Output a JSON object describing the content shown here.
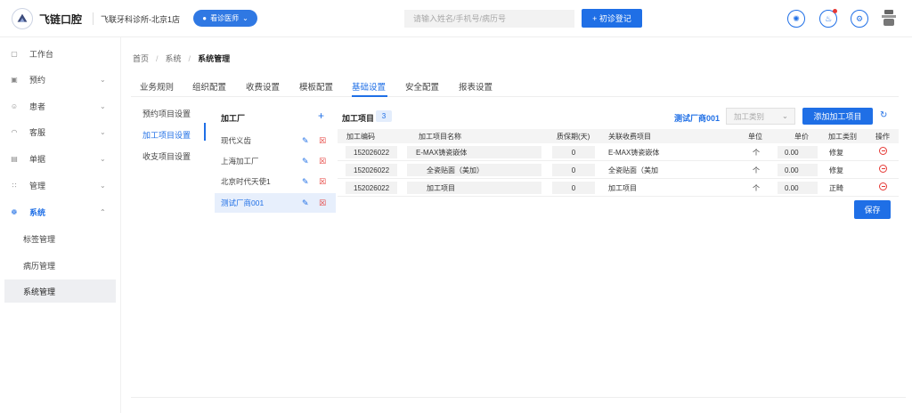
{
  "header": {
    "brand": "飞链口腔",
    "clinic": "飞联牙科诊所-北京1店",
    "role": "看诊医师",
    "search_placeholder": "请输入姓名/手机号/病历号",
    "register_label": "+ 初诊登记",
    "icons": [
      "sun-icon",
      "bell-icon",
      "settings-icon",
      "avatar-icon"
    ]
  },
  "sidebar": {
    "items": [
      {
        "label": "工作台",
        "icon": "monitor-icon"
      },
      {
        "label": "预约",
        "icon": "calendar-icon"
      },
      {
        "label": "患者",
        "icon": "user-icon"
      },
      {
        "label": "客服",
        "icon": "headset-icon"
      },
      {
        "label": "单据",
        "icon": "receipt-icon"
      },
      {
        "label": "管理",
        "icon": "grid-icon"
      },
      {
        "label": "系统",
        "icon": "gear-icon"
      }
    ],
    "sub_items": [
      "标签管理",
      "病历管理",
      "系统管理"
    ]
  },
  "breadcrumb": [
    "首页",
    "系统",
    "系统管理"
  ],
  "tabs": [
    "业务规则",
    "组织配置",
    "收费设置",
    "模板配置",
    "基础设置",
    "安全配置",
    "报表设置"
  ],
  "submenu": [
    "预约项目设置",
    "加工项目设置",
    "收支项目设置"
  ],
  "factory": {
    "title": "加工厂",
    "add": "+",
    "list": [
      "现代义齿",
      "上海加工厂",
      "北京时代天使1",
      "测试厂商001"
    ]
  },
  "items": {
    "title": "加工项目",
    "count": "3",
    "factory_name": "测试厂商001",
    "category_placeholder": "加工类别",
    "add_label": "添加加工项目",
    "save_label": "保存",
    "columns": [
      "加工编码",
      "加工项目名称",
      "质保期(天)",
      "关联收费项目",
      "单位",
      "单价",
      "加工类别",
      "操作"
    ],
    "rows": [
      {
        "code": "152026022",
        "name": "E-MAX铸瓷嵌体",
        "warranty": "0",
        "fee": "E-MAX铸瓷嵌体",
        "unit": "个",
        "price": "0.00",
        "category": "修复"
      },
      {
        "code": "152026022",
        "name": "全瓷贴面（美加）",
        "warranty": "0",
        "fee": "全瓷贴面（美加",
        "unit": "个",
        "price": "0.00",
        "category": "修复"
      },
      {
        "code": "152026022",
        "name": "加工项目",
        "warranty": "0",
        "fee": "加工项目",
        "unit": "个",
        "price": "0.00",
        "category": "正畸"
      }
    ]
  }
}
